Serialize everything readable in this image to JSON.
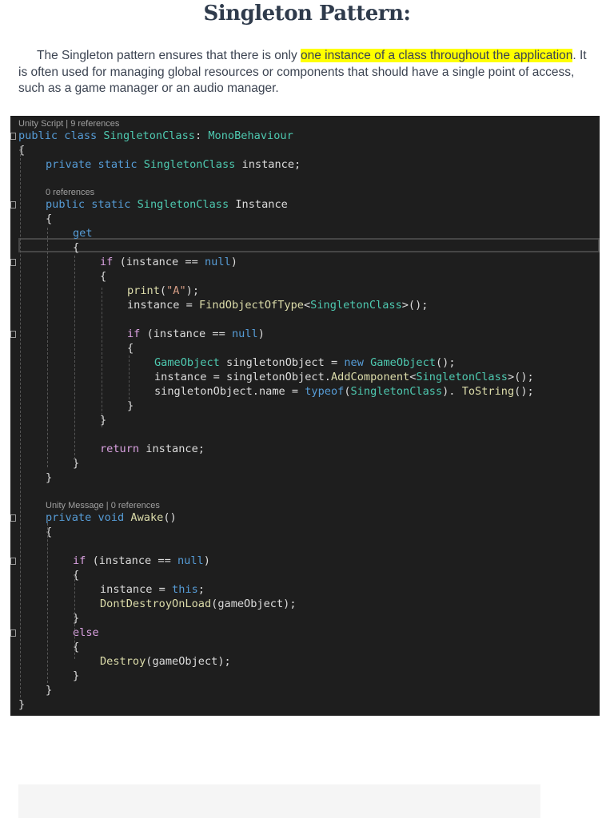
{
  "heading": "Singleton Pattern:",
  "paragraph": {
    "before": "The Singleton pattern ensures that there is only ",
    "highlight": "one instance of a class throughout the application",
    "after": ". It is often used for managing global resources or components that should have a single point of access, such as a game manager or an audio manager."
  },
  "colors": {
    "highlight": "#ffff00",
    "code_bg": "#1e1e1e",
    "keyword": "#569cd6",
    "type": "#4ec9b0",
    "method": "#dcdcaa",
    "control": "#d8a0df"
  },
  "code_lines": [
    {
      "lens": "Unity Script | 9 references"
    },
    {
      "indent": 0,
      "tokens": [
        [
          "kw",
          "public "
        ],
        [
          "kw",
          "class "
        ],
        [
          "ty",
          "SingletonClass"
        ],
        [
          "pl",
          ": "
        ],
        [
          "ty",
          "MonoBehaviour"
        ]
      ]
    },
    {
      "indent": 0,
      "tokens": [
        [
          "pl",
          "{"
        ]
      ]
    },
    {
      "indent": 1,
      "tokens": [
        [
          "kw",
          "private "
        ],
        [
          "kw",
          "static "
        ],
        [
          "ty",
          "SingletonClass "
        ],
        [
          "pl",
          "instance;"
        ]
      ]
    },
    {
      "indent": 1,
      "tokens": []
    },
    {
      "lens": "0 references",
      "indent": 1
    },
    {
      "indent": 1,
      "tokens": [
        [
          "kw",
          "public "
        ],
        [
          "kw",
          "static "
        ],
        [
          "ty",
          "SingletonClass "
        ],
        [
          "pl",
          "Instance"
        ]
      ]
    },
    {
      "indent": 1,
      "tokens": [
        [
          "pl",
          "{"
        ]
      ]
    },
    {
      "indent": 2,
      "tokens": [
        [
          "kw",
          "get"
        ]
      ]
    },
    {
      "indent": 2,
      "tokens": [
        [
          "pl",
          "{"
        ]
      ]
    },
    {
      "indent": 3,
      "tokens": [
        [
          "ct",
          "if "
        ],
        [
          "pl",
          "(instance == "
        ],
        [
          "kw",
          "null"
        ],
        [
          "pl",
          ")"
        ]
      ]
    },
    {
      "indent": 3,
      "tokens": [
        [
          "pl",
          "{"
        ]
      ]
    },
    {
      "indent": 4,
      "tokens": [
        [
          "fn",
          "print"
        ],
        [
          "pl",
          "("
        ],
        [
          "st",
          "\"A\""
        ],
        [
          "pl",
          ");"
        ]
      ]
    },
    {
      "indent": 4,
      "tokens": [
        [
          "pl",
          "instance = "
        ],
        [
          "fn",
          "FindObjectOfType"
        ],
        [
          "pl",
          "<"
        ],
        [
          "ty",
          "SingletonClass"
        ],
        [
          "pl",
          ">();"
        ]
      ]
    },
    {
      "indent": 4,
      "tokens": []
    },
    {
      "indent": 4,
      "tokens": [
        [
          "ct",
          "if "
        ],
        [
          "pl",
          "(instance == "
        ],
        [
          "kw",
          "null"
        ],
        [
          "pl",
          ")"
        ]
      ]
    },
    {
      "indent": 4,
      "tokens": [
        [
          "pl",
          "{"
        ]
      ]
    },
    {
      "indent": 5,
      "tokens": [
        [
          "ty",
          "GameObject "
        ],
        [
          "pl",
          "singletonObject = "
        ],
        [
          "kw",
          "new "
        ],
        [
          "ty",
          "GameObject"
        ],
        [
          "pl",
          "();"
        ]
      ]
    },
    {
      "indent": 5,
      "tokens": [
        [
          "pl",
          "instance = singletonObject."
        ],
        [
          "fn",
          "AddComponent"
        ],
        [
          "pl",
          "<"
        ],
        [
          "ty",
          "SingletonClass"
        ],
        [
          "pl",
          ">();"
        ]
      ]
    },
    {
      "indent": 5,
      "tokens": [
        [
          "pl",
          "singletonObject.name = "
        ],
        [
          "kw",
          "typeof"
        ],
        [
          "pl",
          "("
        ],
        [
          "ty",
          "SingletonClass"
        ],
        [
          "pl",
          "). "
        ],
        [
          "fn",
          "ToString"
        ],
        [
          "pl",
          "();"
        ]
      ]
    },
    {
      "indent": 4,
      "tokens": [
        [
          "pl",
          "}"
        ]
      ]
    },
    {
      "indent": 3,
      "tokens": [
        [
          "pl",
          "}"
        ]
      ]
    },
    {
      "indent": 3,
      "tokens": []
    },
    {
      "indent": 3,
      "tokens": [
        [
          "ct",
          "return "
        ],
        [
          "pl",
          "instance;"
        ]
      ]
    },
    {
      "indent": 2,
      "tokens": [
        [
          "pl",
          "}"
        ]
      ]
    },
    {
      "indent": 1,
      "tokens": [
        [
          "pl",
          "}"
        ]
      ]
    },
    {
      "indent": 1,
      "tokens": []
    },
    {
      "lens": "Unity Message | 0 references",
      "indent": 1
    },
    {
      "indent": 1,
      "tokens": [
        [
          "kw",
          "private "
        ],
        [
          "kw",
          "void "
        ],
        [
          "fn",
          "Awake"
        ],
        [
          "pl",
          "()"
        ]
      ]
    },
    {
      "indent": 1,
      "tokens": [
        [
          "pl",
          "{"
        ]
      ]
    },
    {
      "indent": 1,
      "tokens": []
    },
    {
      "indent": 2,
      "tokens": [
        [
          "ct",
          "if "
        ],
        [
          "pl",
          "(instance == "
        ],
        [
          "kw",
          "null"
        ],
        [
          "pl",
          ")"
        ]
      ]
    },
    {
      "indent": 2,
      "tokens": [
        [
          "pl",
          "{"
        ]
      ]
    },
    {
      "indent": 3,
      "tokens": [
        [
          "pl",
          "instance = "
        ],
        [
          "kw",
          "this"
        ],
        [
          "pl",
          ";"
        ]
      ]
    },
    {
      "indent": 3,
      "tokens": [
        [
          "fn",
          "DontDestroyOnLoad"
        ],
        [
          "pl",
          "(gameObject);"
        ]
      ]
    },
    {
      "indent": 2,
      "tokens": [
        [
          "pl",
          "}"
        ]
      ]
    },
    {
      "indent": 2,
      "tokens": [
        [
          "ct",
          "else"
        ]
      ]
    },
    {
      "indent": 2,
      "tokens": [
        [
          "pl",
          "{"
        ]
      ]
    },
    {
      "indent": 3,
      "tokens": [
        [
          "fn",
          "Destroy"
        ],
        [
          "pl",
          "(gameObject);"
        ]
      ]
    },
    {
      "indent": 2,
      "tokens": [
        [
          "pl",
          "}"
        ]
      ]
    },
    {
      "indent": 1,
      "tokens": [
        [
          "pl",
          "}"
        ]
      ]
    },
    {
      "indent": 0,
      "tokens": [
        [
          "pl",
          "}"
        ]
      ]
    }
  ]
}
